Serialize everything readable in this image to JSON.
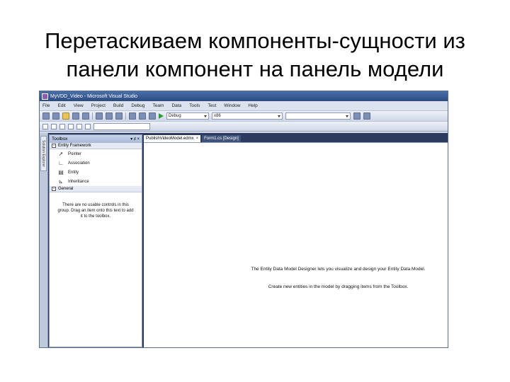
{
  "slide": {
    "title_line1": "Перетаскиваем компоненты-сущности из",
    "title_line2": "панели компонент на панель модели"
  },
  "window": {
    "title": "MyVDD_Video - Microsoft Visual Studio"
  },
  "menu": {
    "items": [
      "File",
      "Edit",
      "View",
      "Project",
      "Build",
      "Debug",
      "Team",
      "Data",
      "Tools",
      "Test",
      "Window",
      "Help"
    ]
  },
  "toolbar": {
    "config_combo": "Debug",
    "platform_combo": "x86"
  },
  "sidebar": {
    "tab_label": "Solution Explorer"
  },
  "toolbox": {
    "title": "Toolbox",
    "controls": "▾ ♯ ×",
    "group1": {
      "expander": "−",
      "label": "Entity Framework",
      "items": [
        {
          "label": "Pointer",
          "icon": "pointer-icon"
        },
        {
          "label": "Association",
          "icon": "association-icon"
        },
        {
          "label": "Entity",
          "icon": "entity-icon"
        },
        {
          "label": "Inheritance",
          "icon": "inheritance-icon"
        }
      ]
    },
    "group2": {
      "expander": "−",
      "label": "General"
    },
    "general_message": "There are no usable controls in this group. Drag an item onto this text to add it to the toolbox."
  },
  "document": {
    "tabs": [
      {
        "label": "PublishVideoModel.edmx",
        "close": "×"
      },
      {
        "label": "Form1.cs [Design]",
        "close": ""
      }
    ],
    "canvas_line1": "The Entity Data Model Designer lets you visualize and design your Entity Data Model.",
    "canvas_line2": "Create new entities in the model by dragging items from the Toolbox."
  },
  "colors": {
    "titlebar": "#2b4a80",
    "workarea": "#2b3a5e"
  }
}
